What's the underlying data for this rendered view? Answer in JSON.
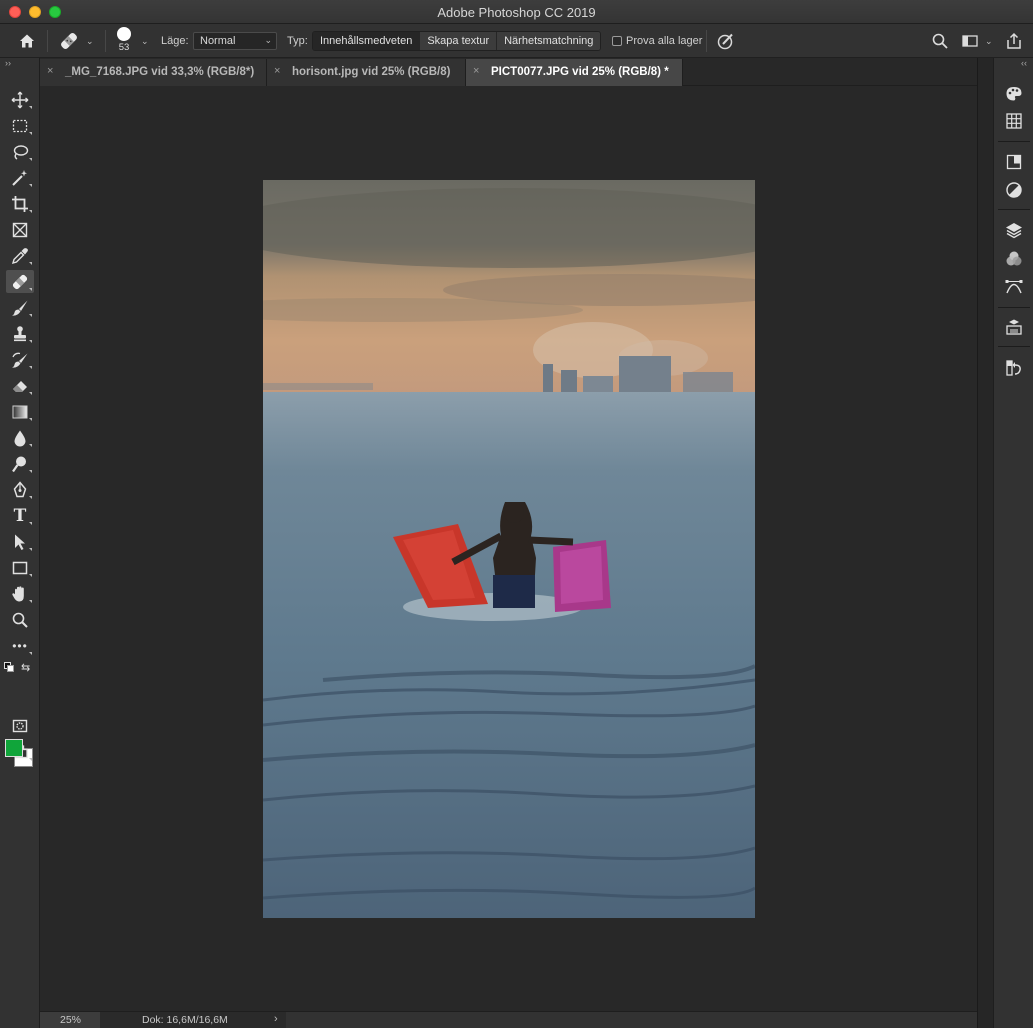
{
  "window": {
    "title": "Adobe Photoshop CC 2019"
  },
  "options_bar": {
    "brush_size": "53",
    "mode_label": "Läge:",
    "mode_value": "Normal",
    "type_label": "Typ:",
    "type_options": [
      "Innehållsmedveten",
      "Skapa textur",
      "Närhetsmatchning"
    ],
    "type_selected": "Innehållsmedveten",
    "sample_all_label": "Prova alla lager",
    "sample_all_checked": false
  },
  "tabs": [
    {
      "label": "_MG_7168.JPG vid 33,3% (RGB/8*)",
      "active": false
    },
    {
      "label": "horisont.jpg vid 25% (RGB/8)",
      "active": false
    },
    {
      "label": "PICT0077.JPG vid 25% (RGB/8) *",
      "active": true
    }
  ],
  "tools": [
    "move-tool",
    "marquee-tool",
    "lasso-tool",
    "magic-wand-tool",
    "crop-tool",
    "frame-tool",
    "eyedropper-tool",
    "spot-healing-brush-tool",
    "brush-tool",
    "clone-stamp-tool",
    "history-brush-tool",
    "eraser-tool",
    "gradient-tool",
    "blur-tool",
    "dodge-tool",
    "pen-tool",
    "type-tool",
    "path-selection-tool",
    "rectangle-tool",
    "hand-tool",
    "zoom-tool",
    "more-tools"
  ],
  "active_tool": "spot-healing-brush-tool",
  "type_tool_glyph": "T",
  "more_tools_glyph": "•••",
  "colors": {
    "foreground": "#10a53a",
    "background": "#ffffff",
    "ui_dark": "#282828",
    "ui_panel": "#323232"
  },
  "right_panel_icons": [
    "color-palette-icon",
    "swatches-grid-icon",
    "libraries-icon",
    "adjustments-icon",
    "layers-icon",
    "channels-icon",
    "paths-icon",
    "properties-3d-icon",
    "history-icon"
  ],
  "status": {
    "zoom": "25%",
    "doc_info": "Dok: 16,6M/16,6M",
    "arrow": "›"
  },
  "glyphs": {
    "tab_close": "×",
    "collapse_left": "››",
    "collapse_right": "‹‹",
    "chevron": "⌄"
  }
}
